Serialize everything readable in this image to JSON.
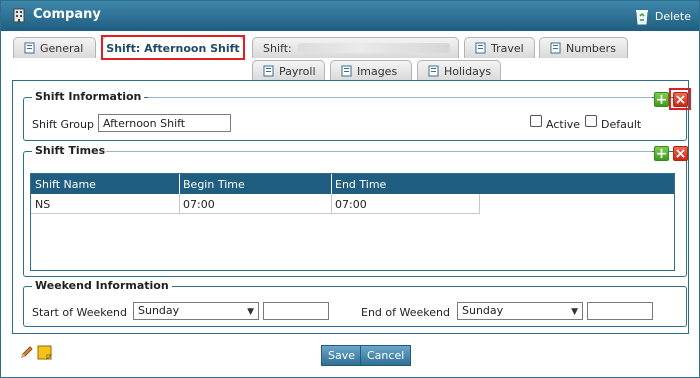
{
  "window": {
    "title": "Company",
    "delete_label": "Delete"
  },
  "tabs": {
    "general": "General",
    "shift_active": "Shift: Afternoon Shift",
    "shift_other": "Shift:",
    "travel": "Travel",
    "numbers": "Numbers",
    "payroll": "Payroll",
    "images": "Images",
    "holidays": "Holidays"
  },
  "shift_info": {
    "legend": "Shift Information",
    "group_label": "Shift Group",
    "group_value": "Afternoon Shift",
    "active_label": "Active",
    "default_label": "Default"
  },
  "shift_times": {
    "legend": "Shift Times",
    "columns": [
      "Shift Name",
      "Begin Time",
      "End Time"
    ],
    "rows": [
      {
        "name": "NS",
        "begin": "07:00",
        "end": "07:00"
      }
    ]
  },
  "weekend": {
    "legend": "Weekend Information",
    "start_label": "Start of Weekend",
    "start_value": "Sunday",
    "end_label": "End of Weekend",
    "end_value": "Sunday"
  },
  "footer": {
    "save_label": "Save",
    "cancel_label": "Cancel"
  },
  "colors": {
    "accent": "#1f5e80",
    "highlight_outline": "#e02020"
  }
}
